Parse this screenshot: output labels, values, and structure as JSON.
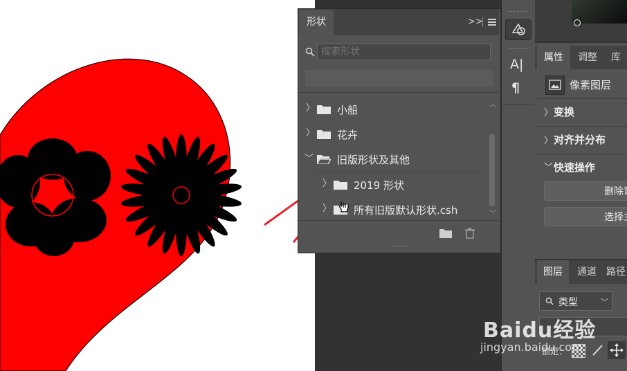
{
  "shapes_panel": {
    "tab_label": "形状",
    "collapse_glyph": ">>",
    "search_placeholder": "搜索形状",
    "items": [
      {
        "label": "小船"
      },
      {
        "label": "花卉"
      },
      {
        "label": "旧版形状及其他"
      },
      {
        "label": "2019 形状"
      },
      {
        "label": "所有旧版默认形状.csh"
      }
    ]
  },
  "tool_strip": {
    "type_tool_glyph": "A|",
    "paragraph_glyph": "¶"
  },
  "properties_panel": {
    "tabs": [
      "属性",
      "调整",
      "库"
    ],
    "layer_type": "像素图层",
    "sections": [
      "变换",
      "对齐并分布",
      "快速操作"
    ],
    "buttons": [
      "删除背",
      "选择主"
    ]
  },
  "layers_panel": {
    "tabs": [
      "图层",
      "通道",
      "路径"
    ],
    "filter_label": "类型",
    "lock_label": "锁定:"
  },
  "watermark": {
    "brand": "Baidu经验",
    "url": "jingyan.baidu.com"
  },
  "colors": {
    "heart": "#ff0000",
    "canvas": "#ffffff",
    "panel": "#535353",
    "dark": "#323232",
    "arrow": "#e8262b"
  }
}
